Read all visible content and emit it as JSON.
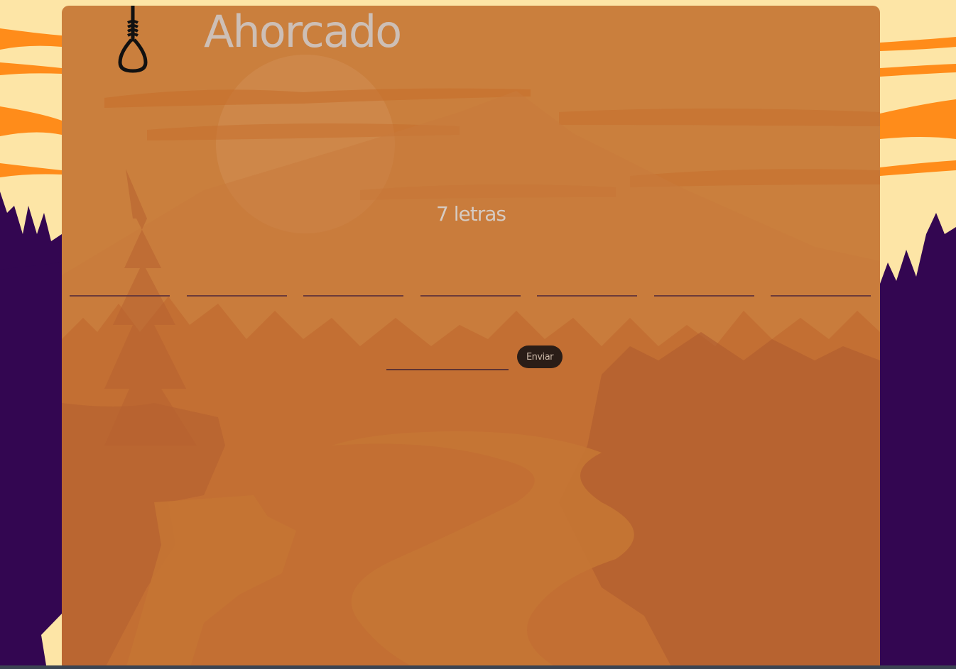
{
  "app": {
    "title": "Ahorcado"
  },
  "game": {
    "letter_count_text": "7 letras",
    "slots": [
      "",
      "",
      "",
      "",
      "",
      "",
      ""
    ]
  },
  "form": {
    "guess_value": "",
    "guess_placeholder": "",
    "send_label": "Enviar"
  },
  "colors": {
    "sky": "#fde5a6",
    "cloud_orange": "#ff8c1a",
    "tree_purple": "#330651",
    "panel": "#c57634",
    "title": "#cdbfb6",
    "button": "#2a1d17",
    "slot_line": "#6b3b3a"
  },
  "icons": {
    "logo": "noose-icon"
  }
}
